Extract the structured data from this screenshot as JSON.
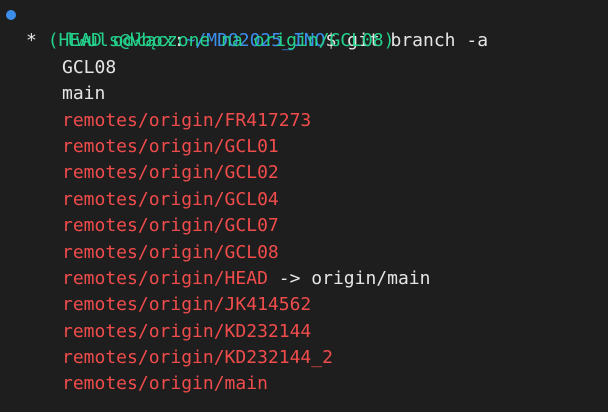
{
  "colors": {
    "background": "#1e1e1e",
    "dot": "#3b8eea",
    "user": "#23d18b",
    "path": "#3b8eea",
    "text": "#e5e5e5",
    "head": "#23d18b",
    "remote": "#f14c4c"
  },
  "prompt": {
    "user": "lwuls@vbox",
    "separator": ":",
    "path": "~/MDO2025_INO",
    "symbol": "$",
    "command": " git branch -a"
  },
  "current_branch": {
    "marker": "* ",
    "name": "(HEAD odłączone na origin/GCL08)"
  },
  "local_branches": [
    "GCL08",
    "main"
  ],
  "remote_branches": [
    "remotes/origin/FR417273",
    "remotes/origin/GCL01",
    "remotes/origin/GCL02",
    "remotes/origin/GCL04",
    "remotes/origin/GCL07",
    "remotes/origin/GCL08",
    "remotes/origin/HEAD",
    "remotes/origin/JK414562",
    "remotes/origin/KD232144",
    "remotes/origin/KD232144_2",
    "remotes/origin/main"
  ],
  "head_pointer": {
    "arrow": " -> ",
    "target": "origin/main"
  }
}
